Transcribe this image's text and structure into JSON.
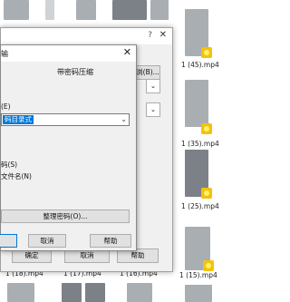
{
  "explorer": {
    "files": [
      {
        "name": "1 (45).mp4"
      },
      {
        "name": "1 (35).mp4"
      },
      {
        "name": "1 (25).mp4"
      },
      {
        "name": "1 (18).mp4"
      },
      {
        "name": "1 (17).mp4"
      },
      {
        "name": "1 (16).mp4"
      },
      {
        "name": "1 (15).mp4"
      }
    ]
  },
  "back_dialog": {
    "question_mark": "?",
    "browse_button": "浏(B)...",
    "ok_button": "确定",
    "cancel_button": "取消",
    "help_button": "帮助"
  },
  "password_dialog": {
    "title": "输",
    "heading": "带密码压缩",
    "field_label": "(E)",
    "password_value": "码目录式",
    "show_password": "码(S)",
    "encrypt_names": "文件名(N)",
    "manage_button": "整理密码(O)...",
    "ok_button": "确定",
    "cancel_button": "取消",
    "help_button": "帮助"
  },
  "colors": {
    "selection": "#0078d7",
    "tag_yellow": "#f4c20d"
  }
}
